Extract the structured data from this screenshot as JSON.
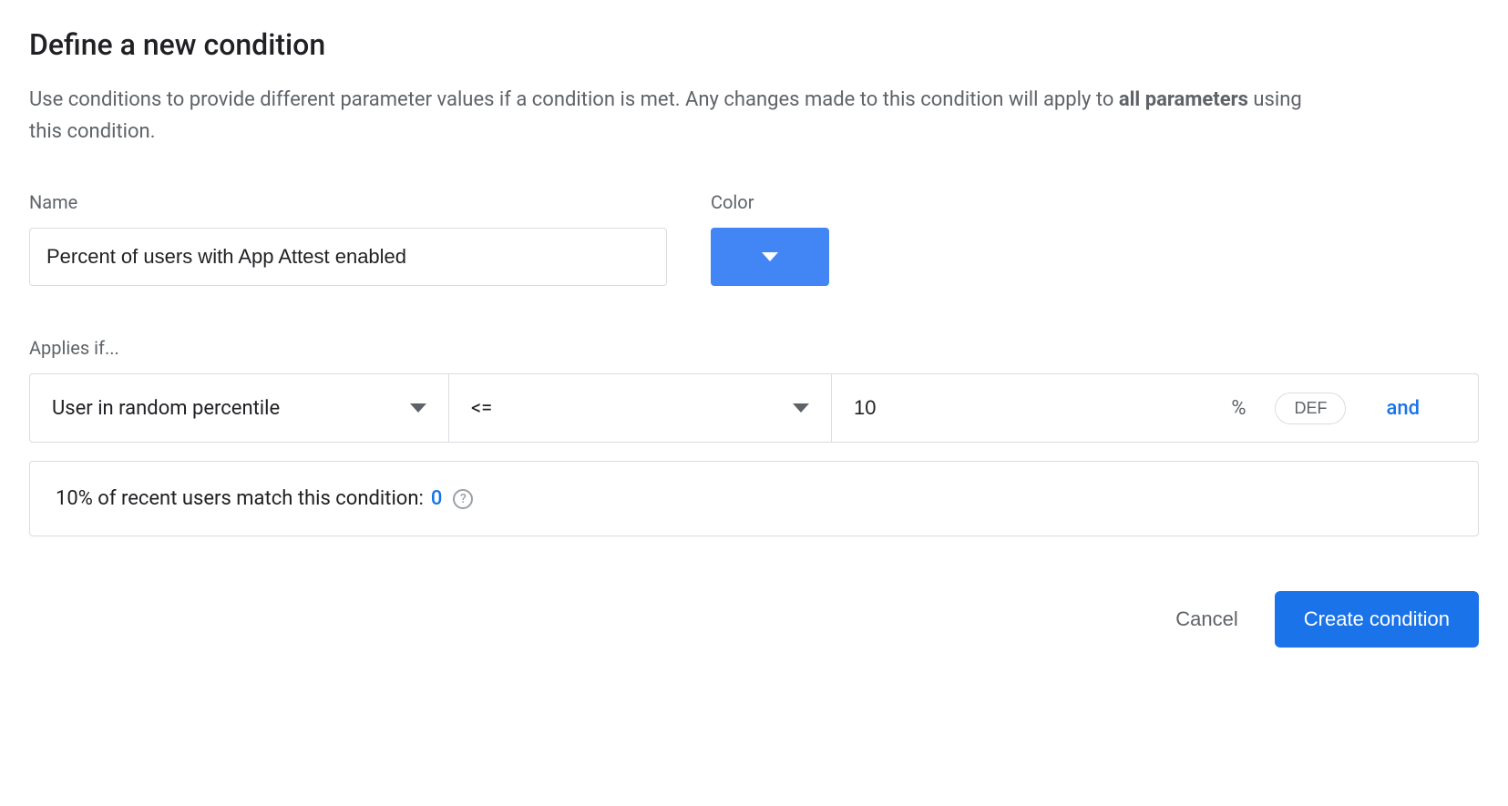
{
  "title": "Define a new condition",
  "description": {
    "prefix": "Use conditions to provide different parameter values if a condition is met. Any changes made to this condition will apply to ",
    "bold": "all parameters",
    "suffix": " using this condition."
  },
  "fields": {
    "name_label": "Name",
    "name_value": "Percent of users with App Attest enabled",
    "color_label": "Color",
    "color_value": "#4285f4"
  },
  "applies_if": {
    "label": "Applies if...",
    "condition_type": "User in random percentile",
    "operator": "<=",
    "value": "10",
    "suffix": "%",
    "chip": "DEF",
    "and_label": "and"
  },
  "match_info": {
    "text": "10% of recent users match this condition: ",
    "count": "0"
  },
  "footer": {
    "cancel": "Cancel",
    "create": "Create condition"
  }
}
